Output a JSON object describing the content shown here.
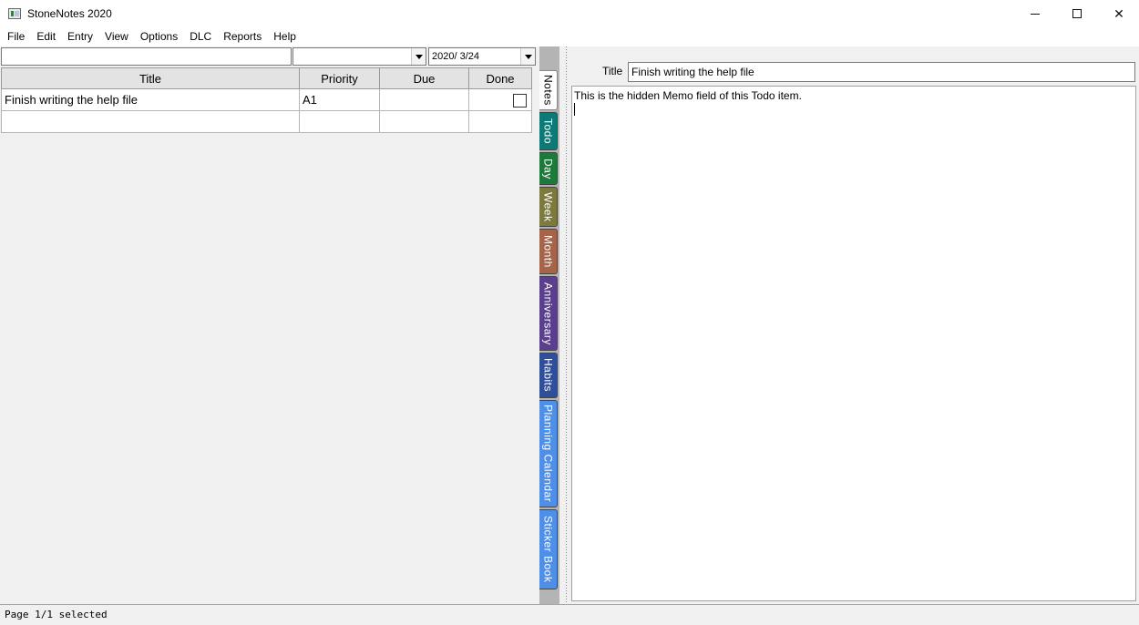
{
  "window": {
    "title": "StoneNotes 2020",
    "minimize": "",
    "maximize": "",
    "close": "✕"
  },
  "menu": [
    "File",
    "Edit",
    "Entry",
    "View",
    "Options",
    "DLC",
    "Reports",
    "Help"
  ],
  "toolbar": {
    "search_value": "",
    "category_value": "",
    "date_value": "2020/  3/24"
  },
  "grid": {
    "columns": [
      "Title",
      "Priority",
      "Due",
      "Done"
    ],
    "rows": [
      {
        "title": "Finish writing the help file",
        "priority": "A1",
        "due": "",
        "done": false
      },
      {
        "title": "",
        "priority": "",
        "due": "",
        "done": null
      }
    ]
  },
  "tabs": [
    {
      "label": "Notes",
      "color": "#ffffff",
      "active": true
    },
    {
      "label": "Todo",
      "color": "#0e7a78"
    },
    {
      "label": "Day",
      "color": "#1e7a3a"
    },
    {
      "label": "Week",
      "color": "#7c7a3e"
    },
    {
      "label": "Month",
      "color": "#a4654a"
    },
    {
      "label": "Anniversary",
      "color": "#5a3f8c"
    },
    {
      "label": "Habits",
      "color": "#2f4f9a"
    },
    {
      "label": "Planning Calendar",
      "color": "#4f8fe8"
    },
    {
      "label": "Sticker Book",
      "color": "#4f8fe8"
    }
  ],
  "detail": {
    "title_label": "Title",
    "title_value": "Finish writing the help file",
    "memo": "This is the hidden Memo field of this Todo item."
  },
  "status": {
    "text": "Page 1/1 selected"
  }
}
